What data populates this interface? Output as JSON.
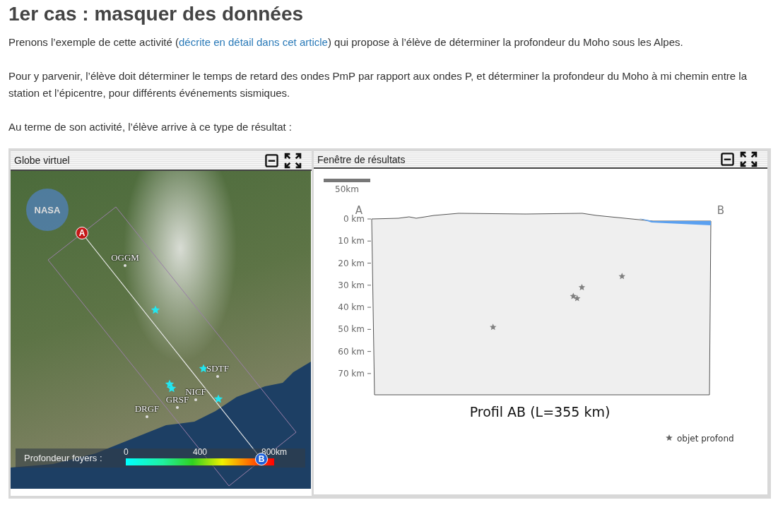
{
  "heading": "1er cas : masquer des données",
  "paragraphs": [
    {
      "before": "Prenons l’exemple de cette activité (",
      "link": "décrite en détail dans cet article",
      "after": ") qui propose à l’élève de déterminer la profondeur du Moho sous les Alpes."
    },
    {
      "before": "Pour y parvenir, l’élève doit déterminer le temps de retard des ondes PmP par rapport aux ondes P, et déterminer la profondeur du Moho à mi chemin entre la station et l’épicentre, pour différents événements sismiques."
    },
    {
      "before": "Au terme de son activité, l’élève arrive à ce type de résultat :"
    }
  ],
  "globe_panel": {
    "title": "Globe virtuel",
    "logo_text": "NASA",
    "marker_a": "A",
    "marker_b": "B",
    "stations": [
      "OGGM",
      "SDTF",
      "NICF",
      "GRSF",
      "DRGF"
    ],
    "legend": {
      "label": "Profondeur foyers :",
      "ticks": [
        "0",
        "400",
        "800km"
      ]
    }
  },
  "results_panel": {
    "title": "Fenêtre de résultats",
    "scale_label": "50km",
    "end_a": "A",
    "end_b": "B",
    "depth_labels": [
      "0 km",
      "10 km",
      "20 km",
      "30 km",
      "40 km",
      "50 km",
      "60 km",
      "70 km"
    ],
    "profile_title": "Profil AB (L=355 km)",
    "legend": "objet profond"
  }
}
